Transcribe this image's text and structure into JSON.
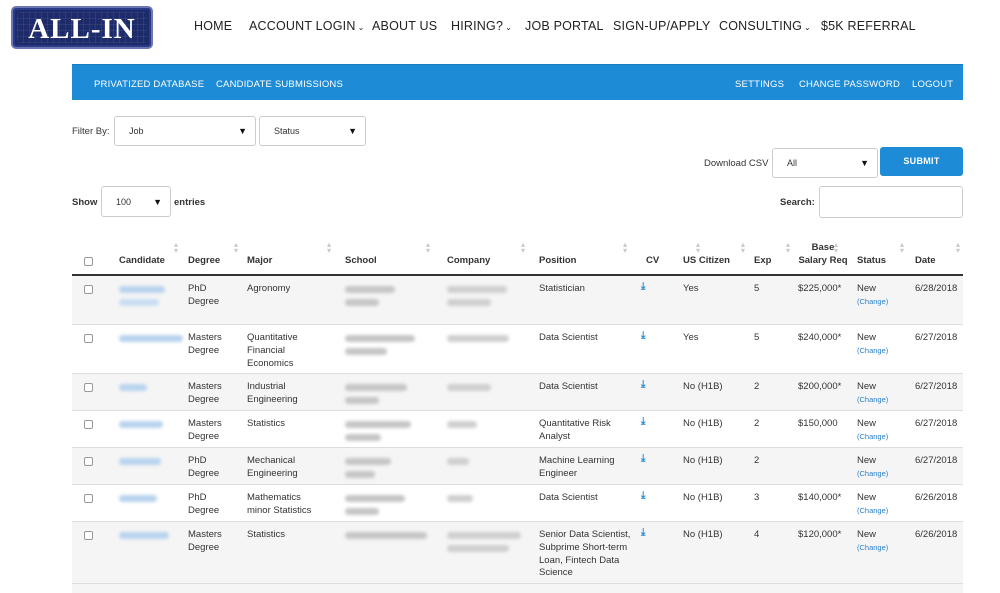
{
  "logo": {
    "text": "ALL-IN"
  },
  "nav": [
    {
      "label": "HOME",
      "caret": false
    },
    {
      "label": "ACCOUNT LOGIN",
      "caret": true
    },
    {
      "label": "ABOUT US",
      "caret": false
    },
    {
      "label": "HIRING?",
      "caret": true
    },
    {
      "label": "JOB PORTAL",
      "caret": false
    },
    {
      "label": "SIGN-UP/APPLY",
      "caret": false
    },
    {
      "label": "CONSULTING",
      "caret": true
    },
    {
      "label": "$5K REFERRAL",
      "caret": false
    }
  ],
  "bluebar": {
    "left": [
      "PRIVATIZED DATABASE",
      "CANDIDATE SUBMISSIONS"
    ],
    "right": [
      "SETTINGS",
      "CHANGE PASSWORD",
      "LOGOUT"
    ]
  },
  "filter": {
    "label": "Filter By:",
    "job": "Job",
    "status": "Status"
  },
  "csv": {
    "label": "Download CSV",
    "value": "All",
    "submit": "SUBMIT"
  },
  "entries": {
    "show": "Show",
    "value": "100",
    "suffix": "entries"
  },
  "search": {
    "label": "Search:"
  },
  "columns": [
    "Candidate",
    "Degree",
    "Major",
    "School",
    "Company",
    "Position",
    "CV",
    "US Citizen",
    "Exp",
    "Base Salary Req",
    "Status",
    "Date"
  ],
  "rows": [
    {
      "degree": "PhD Degree",
      "major": "Agronomy",
      "position": "Statistician",
      "citizen": "Yes",
      "exp": "5",
      "salary": "$225,000*",
      "status": "New",
      "change": "(Change)",
      "date": "6/28/2018"
    },
    {
      "degree": "Masters Degree",
      "major": "Quantitative Financial Economics",
      "position": "Data Scientist",
      "citizen": "Yes",
      "exp": "5",
      "salary": "$240,000*",
      "status": "New",
      "change": "(Change)",
      "date": "6/27/2018"
    },
    {
      "degree": "Masters Degree",
      "major": "Industrial Engineering",
      "position": "Data Scientist",
      "citizen": "No (H1B)",
      "exp": "2",
      "salary": "$200,000*",
      "status": "New",
      "change": "(Change)",
      "date": "6/27/2018"
    },
    {
      "degree": "Masters Degree",
      "major": "Statistics",
      "position": "Quantitative Risk Analyst",
      "citizen": "No (H1B)",
      "exp": "2",
      "salary": "$150,000",
      "status": "New",
      "change": "(Change)",
      "date": "6/27/2018"
    },
    {
      "degree": "PhD Degree",
      "major": "Mechanical Engineering",
      "position": "Machine Learning Engineer",
      "citizen": "No (H1B)",
      "exp": "2",
      "salary": "",
      "status": "New",
      "change": "(Change)",
      "date": "6/27/2018"
    },
    {
      "degree": "PhD Degree",
      "major": "Mathematics minor Statistics",
      "position": "Data Scientist",
      "citizen": "No (H1B)",
      "exp": "3",
      "salary": "$140,000*",
      "status": "New",
      "change": "(Change)",
      "date": "6/26/2018"
    },
    {
      "degree": "Masters Degree",
      "major": "Statistics",
      "position": "Senior Data Scientist, Subprime Short-term Loan, Fintech Data Science",
      "citizen": "No (H1B)",
      "exp": "4",
      "salary": "$120,000*",
      "status": "New",
      "change": "(Change)",
      "date": "6/26/2018"
    }
  ],
  "icons": {
    "download": "download-icon",
    "caret": "chevron-down-icon",
    "sort": "sort-icon"
  },
  "colors": {
    "accent": "#1e8bd6",
    "logo_bg": "#1d2b6b",
    "link": "#2a7fc8"
  }
}
